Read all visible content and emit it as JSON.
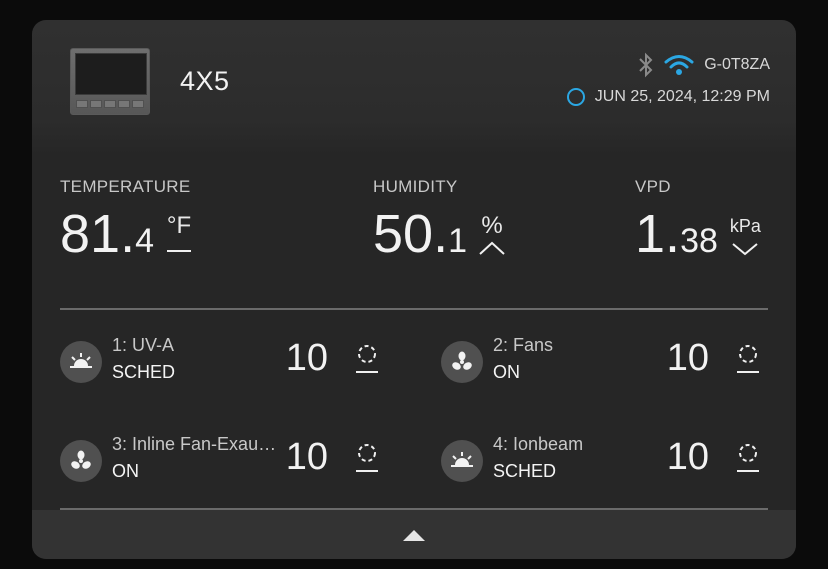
{
  "device": {
    "name": "4X5",
    "id": "G-0T8ZA",
    "datetime": "JUN 25, 2024, 12:29 PM"
  },
  "metrics": [
    {
      "label": "TEMPERATURE",
      "integer": "81",
      "decimal": "4",
      "unit": "°F",
      "trend": "steady"
    },
    {
      "label": "HUMIDITY",
      "integer": "50",
      "decimal": "1",
      "unit": "%",
      "trend": "up"
    },
    {
      "label": "VPD",
      "integer": "1",
      "decimal": "38",
      "unit": "kPa",
      "trend": "down"
    }
  ],
  "outlets": [
    {
      "name": "1: UV-A",
      "mode": "SCHED",
      "level": "10",
      "icon": "sun-rise-icon"
    },
    {
      "name": "2: Fans",
      "mode": "ON",
      "level": "10",
      "icon": "fan-icon"
    },
    {
      "name": "3: Inline Fan-Exau…",
      "mode": "ON",
      "level": "10",
      "icon": "fan-icon"
    },
    {
      "name": "4: Ionbeam",
      "mode": "SCHED",
      "level": "10",
      "icon": "sun-rise-icon"
    }
  ],
  "icons": {
    "bluetooth": "bluetooth-icon",
    "wifi": "wifi-icon",
    "connection": "ring-icon",
    "expand": "caret-up-icon"
  },
  "colors": {
    "accent": "#2ba7e3",
    "card": "#262626",
    "bluetooth_inactive": "#8a8a8a"
  }
}
